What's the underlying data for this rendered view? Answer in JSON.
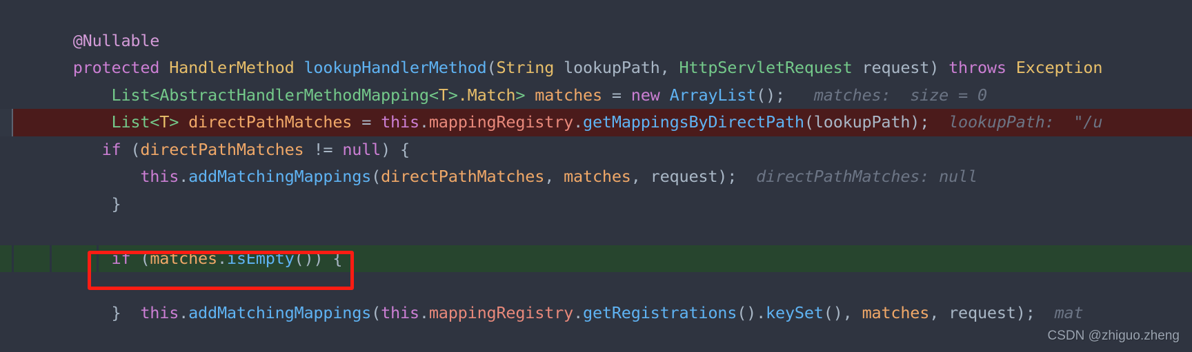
{
  "editor": {
    "theme": "darcula",
    "background": "#2f3440",
    "breakpoint_line_color": "#4b1b1b",
    "execution_line_color": "#27452e",
    "annotation_rect_color": "#fc1c13",
    "lines": [
      {
        "id": "line-annotation",
        "state": "normal",
        "indent": 0,
        "text": "@Nullable"
      },
      {
        "id": "line-method-signature",
        "state": "normal",
        "indent": 0,
        "text": "protected HandlerMethod lookupHandlerMethod(String lookupPath, HttpServletRequest request) throws Exception"
      },
      {
        "id": "line-matches-decl",
        "state": "normal",
        "indent": 1,
        "text": "List<AbstractHandlerMethodMapping<T>.Match> matches = new ArrayList();",
        "hint": "matches:  size = 0"
      },
      {
        "id": "line-directpathmatches-decl",
        "state": "normal",
        "indent": 1,
        "text": "List<T> directPathMatches = this.mappingRegistry.getMappingsByDirectPath(lookupPath);",
        "hint": "lookupPath:  \"/u"
      },
      {
        "id": "line-if-directpathmatches",
        "state": "breakpoint",
        "indent": 1,
        "text": "if (directPathMatches != null) {"
      },
      {
        "id": "line-addmatchingmappings-direct",
        "state": "normal",
        "indent": 2,
        "text": "this.addMatchingMappings(directPathMatches, matches, request);",
        "hint": "directPathMatches: null"
      },
      {
        "id": "line-close-brace-1",
        "state": "normal",
        "indent": 1,
        "text": "}"
      },
      {
        "id": "line-blank",
        "state": "normal",
        "indent": 0,
        "text": ""
      },
      {
        "id": "line-if-matches-isempty",
        "state": "normal",
        "indent": 1,
        "text": "if (matches.isEmpty()) {"
      },
      {
        "id": "line-addmatchingmappings-all",
        "state": "execution",
        "indent": 2,
        "text": "this.addMatchingMappings(this.mappingRegistry.getRegistrations().keySet(), matches, request);",
        "hint": "mat"
      },
      {
        "id": "line-close-brace-2",
        "state": "normal",
        "indent": 1,
        "text": "}"
      }
    ]
  },
  "watermark": {
    "text": "CSDN @zhiguo.zheng"
  }
}
